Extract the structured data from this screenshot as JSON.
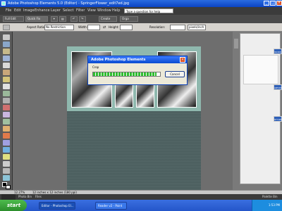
{
  "window": {
    "title": "Adobe Photoshop Elements 5.0 (Editor) - SpringerFlower_edit7ed.jpg"
  },
  "menu": {
    "items": [
      "File",
      "Edit",
      "Image",
      "Enhance",
      "Layer",
      "Select",
      "Filter",
      "View",
      "Window",
      "Help"
    ],
    "help_search_placeholder": "Type a question for help"
  },
  "shortcuts": {
    "full_edit": "Full Edit",
    "quick_fix": "Quick Fix",
    "create": "Create",
    "organize": "Orga"
  },
  "options": {
    "aspect_ratio_label": "Aspect Ratio:",
    "aspect_ratio_value": "No Restriction",
    "width_label": "Width:",
    "height_label": "Height:",
    "resolution_label": "Resolution:",
    "resolution_unit": "pixels/inch"
  },
  "dialog": {
    "title": "Adobe Photoshop Elements",
    "label": "Crop",
    "cancel": "Cancel",
    "progress": 0.95
  },
  "status": {
    "zoom": "12.27%",
    "doc_size": "12 inches x 12 inches (180 ppi)"
  },
  "dock": {
    "photo_bin": "Photo Bin",
    "files_label": "Files",
    "palette_bin": "Palette Bin"
  },
  "taskbar": {
    "start": "start",
    "tasks": [
      "Editor - Photoshop El...",
      "Reader v2 - Paint"
    ],
    "clock": "1:53 PM"
  },
  "palette_tabs": [
    "WORK",
    "ARTWORK",
    "STYLES"
  ]
}
